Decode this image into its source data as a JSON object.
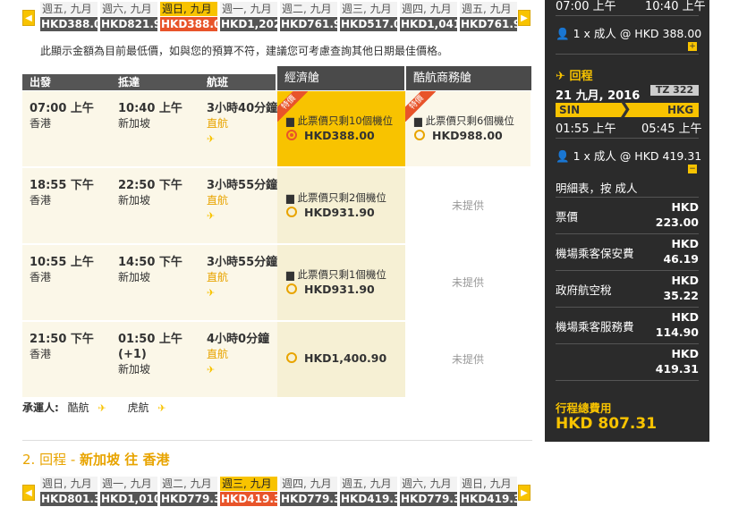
{
  "outbound_strip": {
    "days": [
      {
        "label": "週五, 九月",
        "price": "HKD388.0",
        "selected": false
      },
      {
        "label": "週六, 九月",
        "price": "HKD821.9",
        "selected": false
      },
      {
        "label": "週日, 九月",
        "price": "HKD388.0",
        "selected": true
      },
      {
        "label": "週一, 九月",
        "price": "HKD1,202",
        "selected": false
      },
      {
        "label": "週二, 九月",
        "price": "HKD761.9",
        "selected": false
      },
      {
        "label": "週三, 九月",
        "price": "HKD517.0",
        "selected": false
      },
      {
        "label": "週四, 九月",
        "price": "HKD1,041",
        "selected": false
      },
      {
        "label": "週五, 九月",
        "price": "HKD761.9",
        "selected": false
      }
    ]
  },
  "notice": "此顯示金額為目前最低價，如與您的預算不符，建議您可考慮查詢其他日期最佳價格。",
  "table": {
    "headers": {
      "depart": "出發",
      "arrive": "抵達",
      "flight": "航班",
      "economy": "經濟艙",
      "business": "酷航商務艙"
    },
    "promo_label": "特價",
    "unavailable": "未提供",
    "rows": [
      {
        "dep_time": "07:00 上午",
        "dep_city": "香港",
        "arr_time": "10:40 上午",
        "arr_city": "新加坡",
        "duration": "3小時40分鐘",
        "type": "直航",
        "econ_seats": "此票價只剩10個機位",
        "econ_fare": "HKD388.00",
        "biz_seats": "此票價只剩6個機位",
        "biz_fare": "HKD988.00"
      },
      {
        "dep_time": "18:55 下午",
        "dep_city": "香港",
        "arr_time": "22:50 下午",
        "arr_city": "新加坡",
        "duration": "3小時55分鐘",
        "type": "直航",
        "econ_seats": "此票價只剩2個機位",
        "econ_fare": "HKD931.90"
      },
      {
        "dep_time": "10:55 上午",
        "dep_city": "香港",
        "arr_time": "14:50 下午",
        "arr_city": "新加坡",
        "duration": "3小時55分鐘",
        "type": "直航",
        "econ_seats": "此票價只剩1個機位",
        "econ_fare": "HKD931.90"
      },
      {
        "dep_time": "21:50 下午",
        "dep_city": "香港",
        "arr_time": "01:50 上午",
        "arr_next": "(+1)",
        "arr_city": "新加坡",
        "duration": "4小時0分鐘",
        "type": "直航",
        "econ_fare": "HKD1,400.90"
      }
    ]
  },
  "carriers": {
    "label": "承運人:",
    "a": "酷航",
    "b": "虎航"
  },
  "return_heading": {
    "prefix": "2. 回程 - ",
    "route": "新加坡 往 香港"
  },
  "return_strip": {
    "days": [
      {
        "label": "週日, 九月",
        "price": "HKD801.3",
        "selected": false
      },
      {
        "label": "週一, 九月",
        "price": "HKD1,010",
        "selected": false
      },
      {
        "label": "週二, 九月",
        "price": "HKD779.3",
        "selected": false
      },
      {
        "label": "週三, 九月",
        "price": "HKD419.3",
        "selected": true
      },
      {
        "label": "週四, 九月",
        "price": "HKD779.3",
        "selected": false
      },
      {
        "label": "週五, 九月",
        "price": "HKD419.3",
        "selected": false
      },
      {
        "label": "週六, 九月",
        "price": "HKD779.3",
        "selected": false
      },
      {
        "label": "週日, 九月",
        "price": "HKD419.3",
        "selected": false
      }
    ]
  },
  "sidebar": {
    "top_dep": "07:00 上午",
    "top_arr": "10:40 上午",
    "top_pax": "1 x 成人 @ HKD 388.00",
    "return_label": "回程",
    "return_date": "21 九月, 2016",
    "flight_no": "TZ 322",
    "from": "SIN",
    "to": "HKG",
    "dep_time": "01:55 上午",
    "arr_time": "05:45 上午",
    "pax": "1 x 成人 @ HKD 419.31",
    "breakdown_title": "明細表，按 成人",
    "lines": [
      {
        "label": "票價",
        "cur": "HKD",
        "amt": "223.00"
      },
      {
        "label": "機場乘客保安費",
        "cur": "HKD",
        "amt": "46.19"
      },
      {
        "label": "政府航空稅",
        "cur": "HKD",
        "amt": "35.22"
      },
      {
        "label": "機場乘客服務費",
        "cur": "HKD",
        "amt": "114.90"
      },
      {
        "label": "",
        "cur": "HKD",
        "amt": "419.31"
      }
    ],
    "total_label": "行程總費用",
    "total": "HKD 807.31"
  }
}
